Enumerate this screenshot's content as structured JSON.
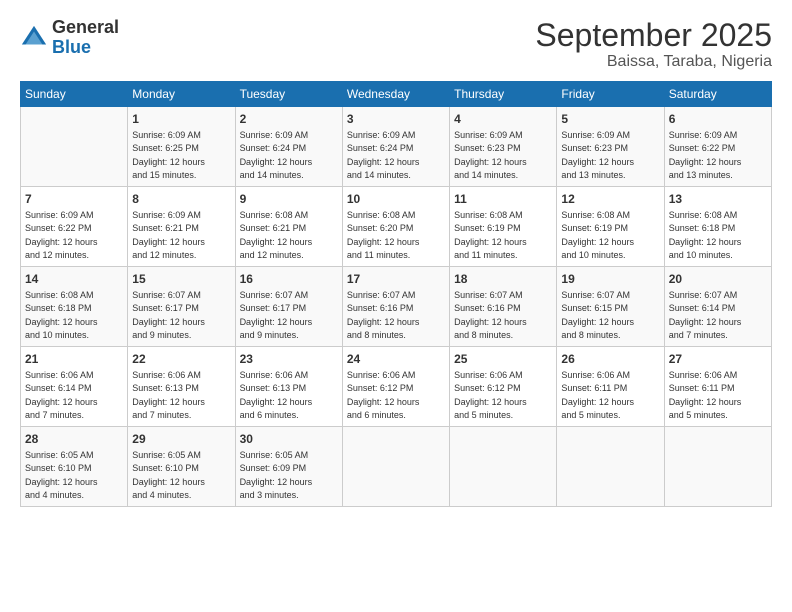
{
  "logo": {
    "general": "General",
    "blue": "Blue"
  },
  "title": "September 2025",
  "subtitle": "Baissa, Taraba, Nigeria",
  "days_header": [
    "Sunday",
    "Monday",
    "Tuesday",
    "Wednesday",
    "Thursday",
    "Friday",
    "Saturday"
  ],
  "weeks": [
    [
      {
        "day": "",
        "info": ""
      },
      {
        "day": "1",
        "info": "Sunrise: 6:09 AM\nSunset: 6:25 PM\nDaylight: 12 hours\nand 15 minutes."
      },
      {
        "day": "2",
        "info": "Sunrise: 6:09 AM\nSunset: 6:24 PM\nDaylight: 12 hours\nand 14 minutes."
      },
      {
        "day": "3",
        "info": "Sunrise: 6:09 AM\nSunset: 6:24 PM\nDaylight: 12 hours\nand 14 minutes."
      },
      {
        "day": "4",
        "info": "Sunrise: 6:09 AM\nSunset: 6:23 PM\nDaylight: 12 hours\nand 14 minutes."
      },
      {
        "day": "5",
        "info": "Sunrise: 6:09 AM\nSunset: 6:23 PM\nDaylight: 12 hours\nand 13 minutes."
      },
      {
        "day": "6",
        "info": "Sunrise: 6:09 AM\nSunset: 6:22 PM\nDaylight: 12 hours\nand 13 minutes."
      }
    ],
    [
      {
        "day": "7",
        "info": "Sunrise: 6:09 AM\nSunset: 6:22 PM\nDaylight: 12 hours\nand 12 minutes."
      },
      {
        "day": "8",
        "info": "Sunrise: 6:09 AM\nSunset: 6:21 PM\nDaylight: 12 hours\nand 12 minutes."
      },
      {
        "day": "9",
        "info": "Sunrise: 6:08 AM\nSunset: 6:21 PM\nDaylight: 12 hours\nand 12 minutes."
      },
      {
        "day": "10",
        "info": "Sunrise: 6:08 AM\nSunset: 6:20 PM\nDaylight: 12 hours\nand 11 minutes."
      },
      {
        "day": "11",
        "info": "Sunrise: 6:08 AM\nSunset: 6:19 PM\nDaylight: 12 hours\nand 11 minutes."
      },
      {
        "day": "12",
        "info": "Sunrise: 6:08 AM\nSunset: 6:19 PM\nDaylight: 12 hours\nand 10 minutes."
      },
      {
        "day": "13",
        "info": "Sunrise: 6:08 AM\nSunset: 6:18 PM\nDaylight: 12 hours\nand 10 minutes."
      }
    ],
    [
      {
        "day": "14",
        "info": "Sunrise: 6:08 AM\nSunset: 6:18 PM\nDaylight: 12 hours\nand 10 minutes."
      },
      {
        "day": "15",
        "info": "Sunrise: 6:07 AM\nSunset: 6:17 PM\nDaylight: 12 hours\nand 9 minutes."
      },
      {
        "day": "16",
        "info": "Sunrise: 6:07 AM\nSunset: 6:17 PM\nDaylight: 12 hours\nand 9 minutes."
      },
      {
        "day": "17",
        "info": "Sunrise: 6:07 AM\nSunset: 6:16 PM\nDaylight: 12 hours\nand 8 minutes."
      },
      {
        "day": "18",
        "info": "Sunrise: 6:07 AM\nSunset: 6:16 PM\nDaylight: 12 hours\nand 8 minutes."
      },
      {
        "day": "19",
        "info": "Sunrise: 6:07 AM\nSunset: 6:15 PM\nDaylight: 12 hours\nand 8 minutes."
      },
      {
        "day": "20",
        "info": "Sunrise: 6:07 AM\nSunset: 6:14 PM\nDaylight: 12 hours\nand 7 minutes."
      }
    ],
    [
      {
        "day": "21",
        "info": "Sunrise: 6:06 AM\nSunset: 6:14 PM\nDaylight: 12 hours\nand 7 minutes."
      },
      {
        "day": "22",
        "info": "Sunrise: 6:06 AM\nSunset: 6:13 PM\nDaylight: 12 hours\nand 7 minutes."
      },
      {
        "day": "23",
        "info": "Sunrise: 6:06 AM\nSunset: 6:13 PM\nDaylight: 12 hours\nand 6 minutes."
      },
      {
        "day": "24",
        "info": "Sunrise: 6:06 AM\nSunset: 6:12 PM\nDaylight: 12 hours\nand 6 minutes."
      },
      {
        "day": "25",
        "info": "Sunrise: 6:06 AM\nSunset: 6:12 PM\nDaylight: 12 hours\nand 5 minutes."
      },
      {
        "day": "26",
        "info": "Sunrise: 6:06 AM\nSunset: 6:11 PM\nDaylight: 12 hours\nand 5 minutes."
      },
      {
        "day": "27",
        "info": "Sunrise: 6:06 AM\nSunset: 6:11 PM\nDaylight: 12 hours\nand 5 minutes."
      }
    ],
    [
      {
        "day": "28",
        "info": "Sunrise: 6:05 AM\nSunset: 6:10 PM\nDaylight: 12 hours\nand 4 minutes."
      },
      {
        "day": "29",
        "info": "Sunrise: 6:05 AM\nSunset: 6:10 PM\nDaylight: 12 hours\nand 4 minutes."
      },
      {
        "day": "30",
        "info": "Sunrise: 6:05 AM\nSunset: 6:09 PM\nDaylight: 12 hours\nand 3 minutes."
      },
      {
        "day": "",
        "info": ""
      },
      {
        "day": "",
        "info": ""
      },
      {
        "day": "",
        "info": ""
      },
      {
        "day": "",
        "info": ""
      }
    ]
  ]
}
